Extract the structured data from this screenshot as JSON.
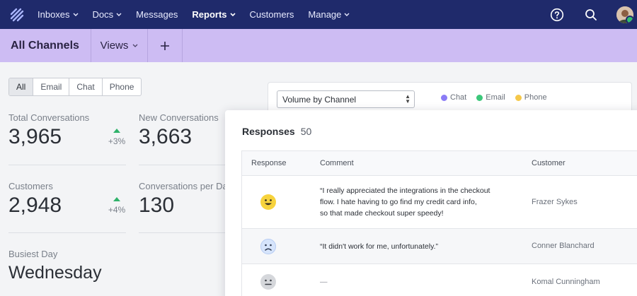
{
  "nav": {
    "items": [
      {
        "label": "Inboxes",
        "has_dropdown": true
      },
      {
        "label": "Docs",
        "has_dropdown": true
      },
      {
        "label": "Messages",
        "has_dropdown": false
      },
      {
        "label": "Reports",
        "has_dropdown": true,
        "active": true
      },
      {
        "label": "Customers",
        "has_dropdown": false
      },
      {
        "label": "Manage",
        "has_dropdown": true
      }
    ],
    "icons": [
      "help-icon",
      "search-icon",
      "user-avatar"
    ]
  },
  "subheader": {
    "title": "All Channels",
    "views_label": "Views",
    "add_icon": "plus-icon"
  },
  "filters": {
    "options": [
      "All",
      "Email",
      "Chat",
      "Phone"
    ],
    "selected": "All"
  },
  "stats": {
    "total_conversations": {
      "label": "Total Conversations",
      "value": "3,965",
      "delta": "+3%"
    },
    "new_conversations": {
      "label": "New Conversations",
      "value": "3,663"
    },
    "customers": {
      "label": "Customers",
      "value": "2,948",
      "delta": "+4%"
    },
    "conversations_per_day": {
      "label": "Conversations per Da",
      "value": "130"
    },
    "busiest_day": {
      "label": "Busiest Day",
      "value": "Wednesday"
    }
  },
  "chart": {
    "select_value": "Volume by Channel",
    "legend": [
      {
        "label": "Chat",
        "color": "#8b7cf6"
      },
      {
        "label": "Email",
        "color": "#3cc77a"
      },
      {
        "label": "Phone",
        "color": "#f5c84a"
      }
    ]
  },
  "responses": {
    "title": "Responses",
    "count": "50",
    "columns": [
      "Response",
      "Comment",
      "Customer"
    ],
    "rows": [
      {
        "response": "happy-face-icon",
        "comment_lines": [
          "“I really appreciated the integrations in the checkout",
          "flow. I hate having to go find my credit card info,",
          "so that made checkout super speedy!"
        ],
        "customer": "Frazer Sykes"
      },
      {
        "response": "sad-face-icon",
        "comment_lines": [
          "“It didn't work for me, unfortunately.”"
        ],
        "customer": "Conner Blanchard"
      },
      {
        "response": "neutral-face-icon",
        "comment_lines": [
          "—"
        ],
        "customer": "Komal Cunningham"
      }
    ]
  }
}
